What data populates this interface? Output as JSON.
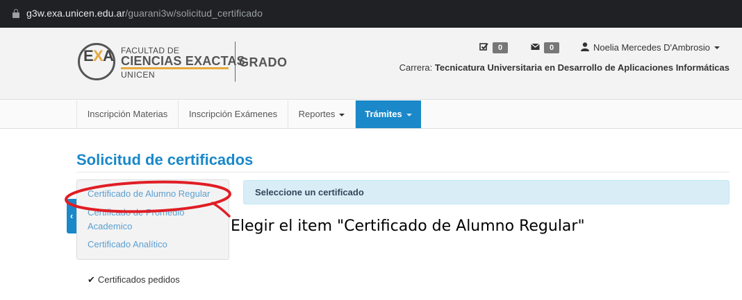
{
  "browser": {
    "url_host": "g3w.exa.unicen.edu.ar",
    "url_path": "/guarani3w/solicitud_certificado"
  },
  "header": {
    "logo": {
      "letter_e": "E",
      "letter_x": "X",
      "letter_a": "A",
      "line1": "FACULTAD DE",
      "line2": "CIENCIAS EXACTAS",
      "line3": "UNICEN",
      "grado": "GRADO"
    },
    "inbox_count": "0",
    "mail_count": "0",
    "user_name": "Noelia Mercedes D'Ambrosio",
    "carrera_label": "Carrera:",
    "carrera_value": "Tecnicatura Universitaria en Desarrollo de Aplicaciones Informáticas",
    "icons": [
      "lock-icon",
      "checkbox-icon",
      "envelope-icon",
      "user-icon"
    ]
  },
  "nav": {
    "items": [
      {
        "label": "Inscripción Materias"
      },
      {
        "label": "Inscripción Exámenes"
      },
      {
        "label": "Reportes"
      },
      {
        "label": "Trámites"
      }
    ],
    "active_color": "#1a88c9"
  },
  "main": {
    "title": "Solicitud de certificados",
    "sidebar": {
      "items": [
        {
          "label": "Certificado de Alumno Regular"
        },
        {
          "label": "Certificado de Promedio Academico"
        },
        {
          "label": "Certificado Analítico"
        }
      ]
    },
    "alert": "Seleccione un certificado",
    "pedidos": "Certificados pedidos"
  },
  "annotation": {
    "text": "Elegir el item \"Certificado de Alumno Regular\"",
    "color": "#e01e25"
  }
}
